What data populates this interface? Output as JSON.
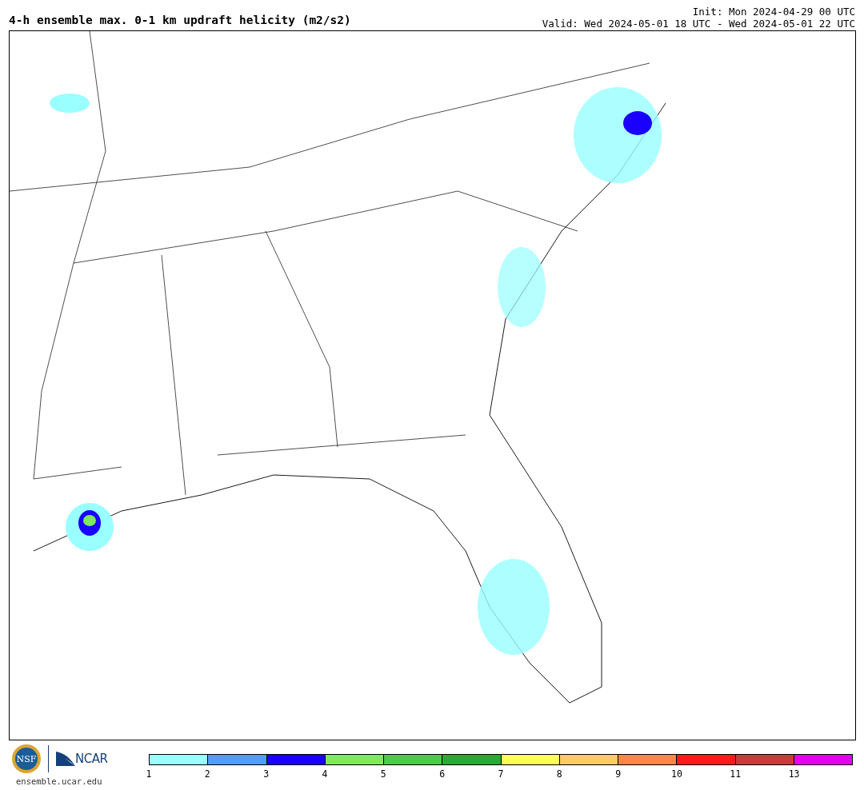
{
  "title": "4-h ensemble max. 0-1 km updraft helicity (m2/s2)",
  "init": "Init: Mon 2024-04-29 00 UTC",
  "valid": "Valid: Wed 2024-05-01 18 UTC - Wed 2024-05-01 22 UTC",
  "logos": {
    "nsf": "NSF",
    "ncar": "NCAR",
    "site": "ensemble.ucar.edu"
  },
  "colorbar": [
    {
      "label": "1",
      "color": "#99ffff"
    },
    {
      "label": "2",
      "color": "#4f9ef8"
    },
    {
      "label": "3",
      "color": "#1a00ff"
    },
    {
      "label": "4",
      "color": "#7ee95a"
    },
    {
      "label": "5",
      "color": "#4ccc44"
    },
    {
      "label": "6",
      "color": "#2aaa34"
    },
    {
      "label": "7",
      "color": "#ffff5a"
    },
    {
      "label": "8",
      "color": "#ffc966"
    },
    {
      "label": "9",
      "color": "#ff8644"
    },
    {
      "label": "10",
      "color": "#ff1a1a"
    },
    {
      "label": "11",
      "color": "#c83c3c"
    },
    {
      "label": "13",
      "color": "#e600ee"
    }
  ]
}
